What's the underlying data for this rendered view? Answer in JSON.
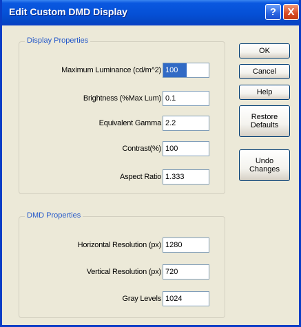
{
  "window": {
    "title": "Edit Custom DMD Display",
    "help_label": "?",
    "close_label": "X"
  },
  "display_properties": {
    "label": "Display Properties",
    "fields": [
      {
        "label": "Maximum Luminance (cd/m^2)",
        "value": "100",
        "selected": true
      },
      {
        "label": "Brightness (%Max Lum)",
        "value": "0.1"
      },
      {
        "label": "Equivalent Gamma",
        "value": "2.2"
      },
      {
        "label": "Contrast(%)",
        "value": "100"
      },
      {
        "label": "Aspect Ratio",
        "value": "1.333"
      }
    ]
  },
  "dmd_properties": {
    "label": "DMD Properties",
    "fields": [
      {
        "label": "Horizontal Resolution (px)",
        "value": "1280"
      },
      {
        "label": "Vertical Resolution (px)",
        "value": "720"
      },
      {
        "label": "Gray Levels",
        "value": "1024"
      }
    ]
  },
  "buttons": {
    "ok": "OK",
    "cancel": "Cancel",
    "help": "Help",
    "restore": "Restore\nDefaults",
    "undo": "Undo\nChanges"
  },
  "colors": {
    "titlebar": "#0a58e0",
    "group_label": "#2156c9",
    "dialog_bg": "#ece9d8",
    "selection": "#316ac5"
  },
  "icons": {
    "help": "question-icon",
    "close": "close-icon"
  }
}
